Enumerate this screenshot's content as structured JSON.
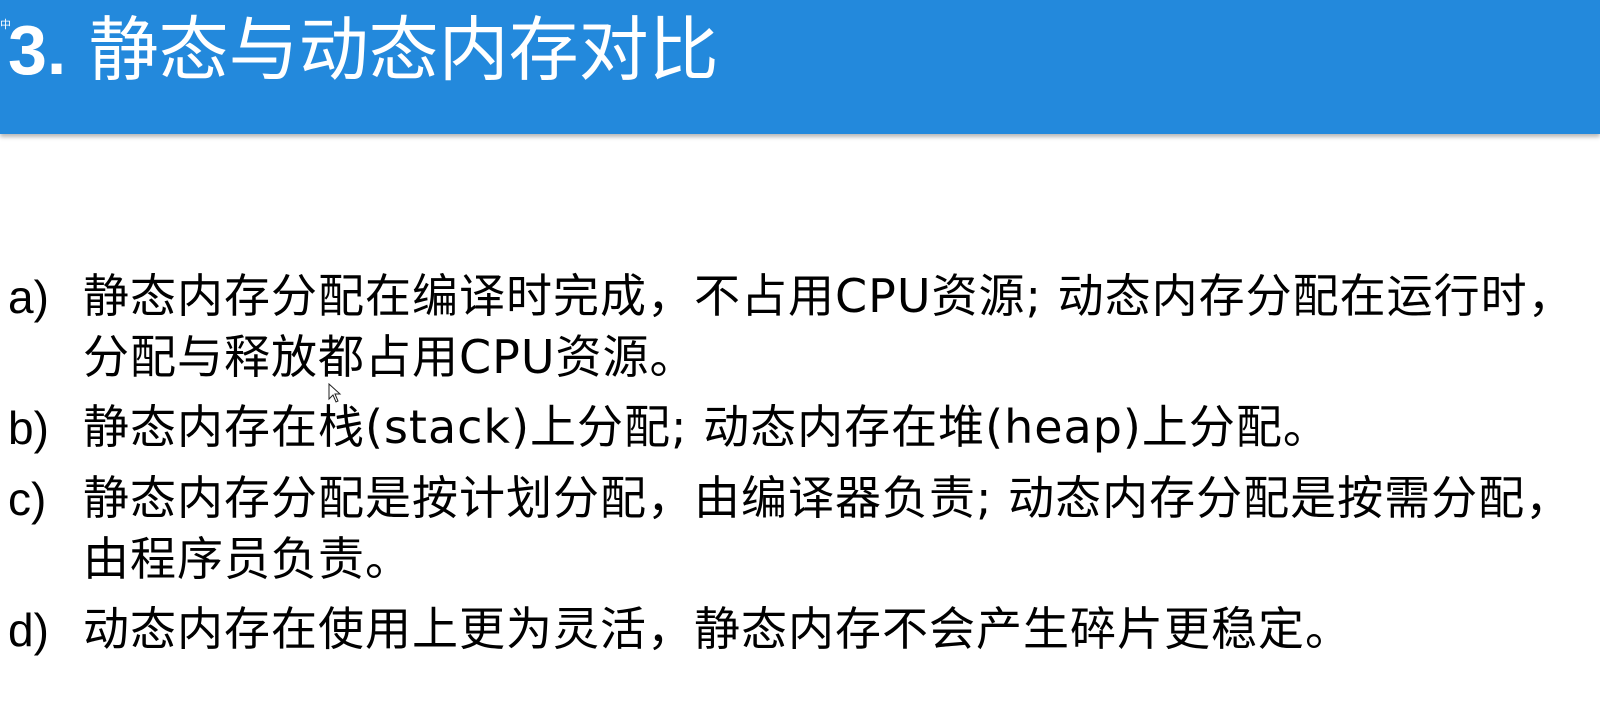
{
  "slide": {
    "corner_mark": "中",
    "title_number": "3.",
    "title_text": "静态与动态内存对比",
    "items": [
      {
        "marker": "a)",
        "text": "静态内存分配在编译时完成，不占用CPU资源; 动态内存分配在运行时，分配与释放都占用CPU资源。"
      },
      {
        "marker": "b)",
        "text": "静态内存在栈(stack)上分配; 动态内存在堆(heap)上分配。"
      },
      {
        "marker": "c)",
        "text": "静态内存分配是按计划分配，由编译器负责; 动态内存分配是按需分配，由程序员负责。"
      },
      {
        "marker": "d)",
        "text": "动态内存在使用上更为灵活，静态内存不会产生碎片更稳定。"
      }
    ]
  },
  "colors": {
    "title_bar": "#2389dc",
    "title_text": "#ffffff",
    "body_text": "#000000",
    "background": "#ffffff"
  },
  "icons": {
    "cursor": "mouse-pointer-icon"
  }
}
